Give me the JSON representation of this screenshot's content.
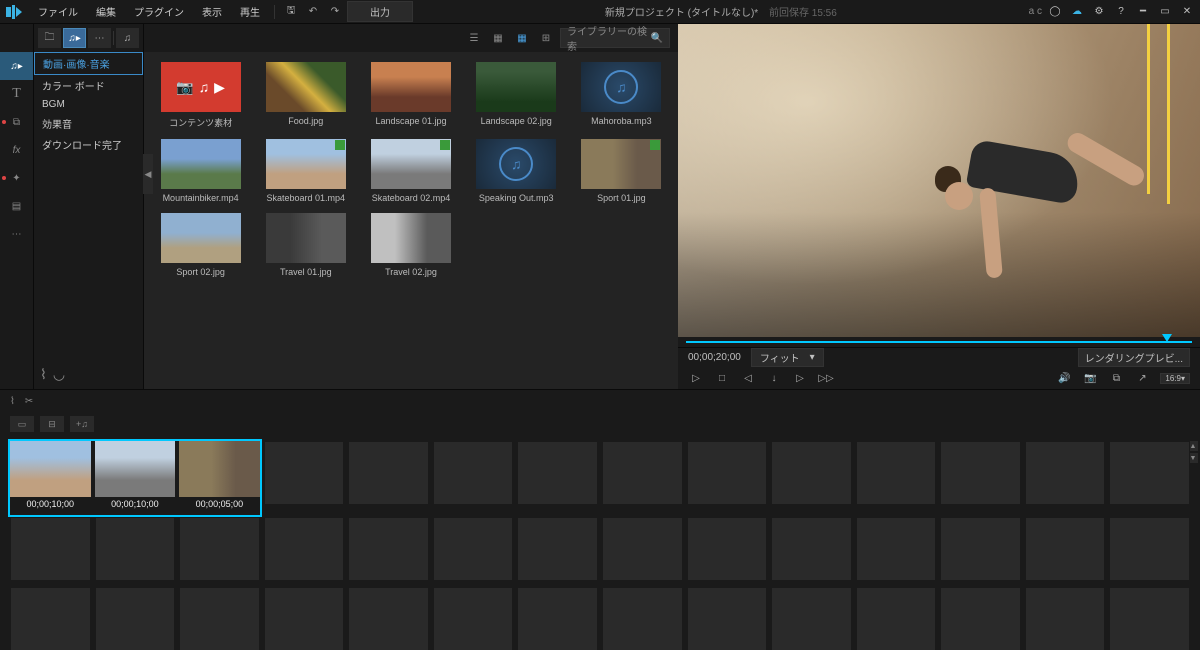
{
  "menubar": {
    "items": [
      "ファイル",
      "編集",
      "プラグイン",
      "表示",
      "再生"
    ],
    "output_label": "出力",
    "project_title": "新規プロジェクト (タイトルなし)*",
    "save_prefix": "前回保存",
    "save_time": "15:56",
    "user": "a c"
  },
  "sidebar": {
    "items": [
      {
        "label": "動画·画像·音楽",
        "selected": true
      },
      {
        "label": "カラー ボード",
        "selected": false
      },
      {
        "label": "BGM",
        "selected": false
      },
      {
        "label": "効果音",
        "selected": false
      },
      {
        "label": "ダウンロード完了",
        "selected": false
      }
    ]
  },
  "library": {
    "search_placeholder": "ライブラリーの検索",
    "items": [
      {
        "label": "コンテンツ素材",
        "type": "content"
      },
      {
        "label": "Food.jpg",
        "type": "image",
        "thumb": "thumb-food"
      },
      {
        "label": "Landscape 01.jpg",
        "type": "image",
        "thumb": "thumb-land1"
      },
      {
        "label": "Landscape 02.jpg",
        "type": "image",
        "thumb": "thumb-land2"
      },
      {
        "label": "Mahoroba.mp3",
        "type": "audio"
      },
      {
        "label": "Mountainbiker.mp4",
        "type": "video",
        "thumb": "thumb-bike"
      },
      {
        "label": "Skateboard 01.mp4",
        "type": "video",
        "thumb": "thumb-skate1",
        "used": true
      },
      {
        "label": "Skateboard 02.mp4",
        "type": "video",
        "thumb": "thumb-skate2",
        "used": true
      },
      {
        "label": "Speaking Out.mp3",
        "type": "audio"
      },
      {
        "label": "Sport 01.jpg",
        "type": "image",
        "thumb": "thumb-sport1",
        "used": true
      },
      {
        "label": "Sport 02.jpg",
        "type": "image",
        "thumb": "thumb-sport2"
      },
      {
        "label": "Travel 01.jpg",
        "type": "image",
        "thumb": "thumb-travel1"
      },
      {
        "label": "Travel 02.jpg",
        "type": "image",
        "thumb": "thumb-travel2"
      }
    ]
  },
  "preview": {
    "timecode": "00;00;20;00",
    "zoom_label": "フィット",
    "render_label": "レンダリングプレビ...",
    "aspect": "16:9"
  },
  "storyboard": {
    "clips": [
      {
        "time": "00;00;10;00",
        "thumb": "thumb-skate1"
      },
      {
        "time": "00;00;10;00",
        "thumb": "thumb-skate2"
      },
      {
        "time": "00;00;05;00",
        "thumb": "thumb-sport1"
      }
    ]
  }
}
